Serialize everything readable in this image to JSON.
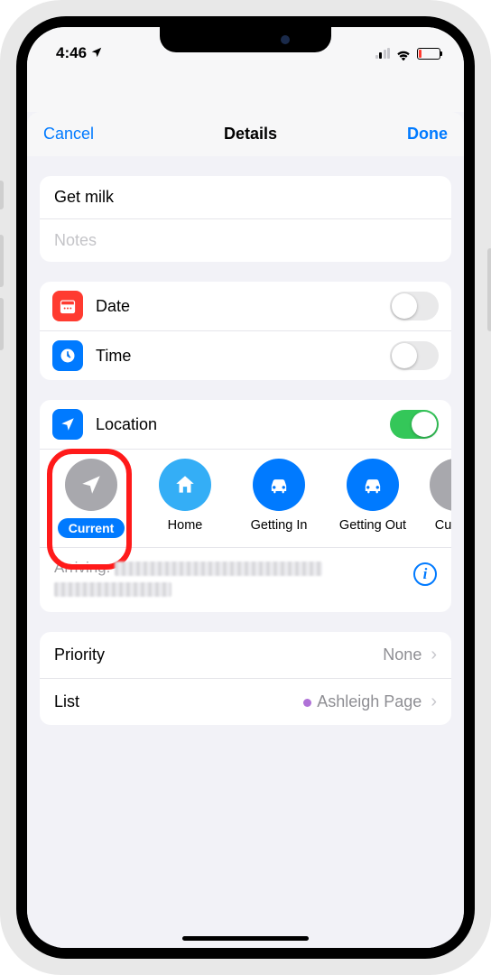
{
  "status": {
    "time": "4:46"
  },
  "nav": {
    "cancel": "Cancel",
    "title": "Details",
    "done": "Done"
  },
  "reminder": {
    "title": "Get milk",
    "notes_placeholder": "Notes"
  },
  "rows": {
    "date": "Date",
    "time": "Time",
    "location": "Location"
  },
  "location_options": {
    "current": "Current",
    "home": "Home",
    "getting_in": "Getting In",
    "getting_out": "Getting Out",
    "custom_partial": "Cu"
  },
  "arriving": {
    "label": "Arriving:"
  },
  "details": {
    "priority_label": "Priority",
    "priority_value": "None",
    "list_label": "List",
    "list_value": "Ashleigh Page"
  }
}
